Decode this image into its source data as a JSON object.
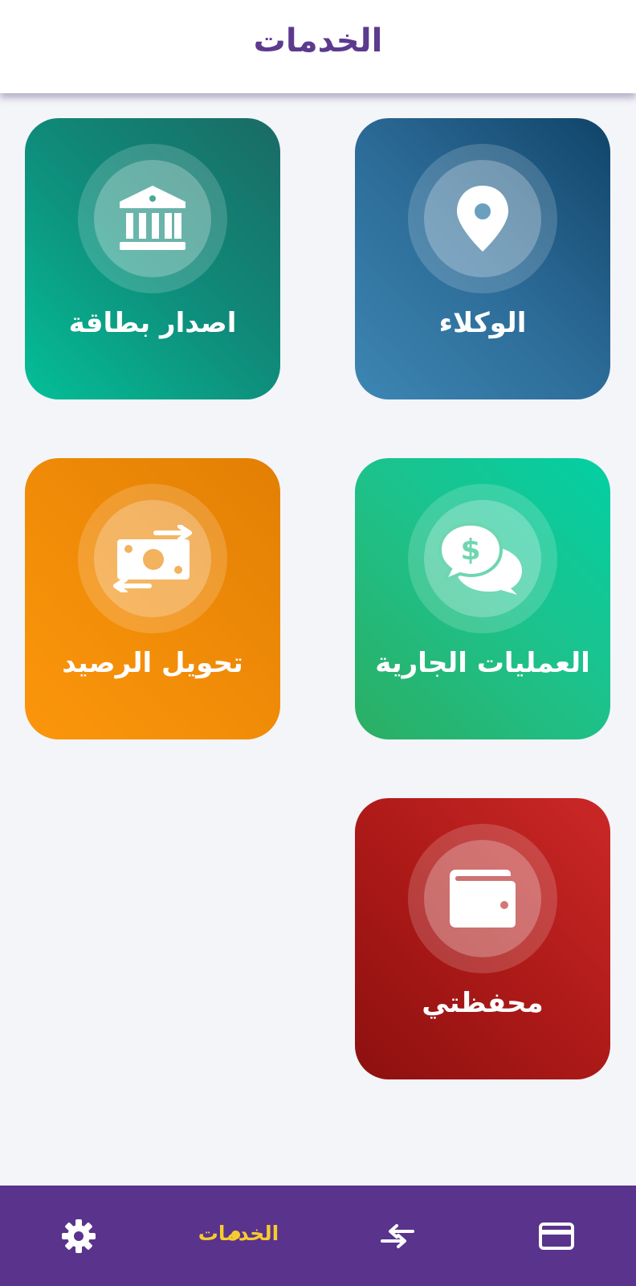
{
  "header": {
    "title": "الخدمات"
  },
  "tiles": [
    {
      "label": "الوكلاء",
      "icon": "map-pin-icon"
    },
    {
      "label": "اصدار بطاقة",
      "icon": "bank-icon"
    },
    {
      "label": "العمليات الجارية",
      "icon": "dollar-chat-icon"
    },
    {
      "label": "تحويل الرصيد",
      "icon": "money-transfer-icon"
    },
    {
      "label": "محفظتي",
      "icon": "wallet-icon"
    }
  ],
  "bottom_nav": {
    "active_label": "الخدمات",
    "items": [
      "credit-card-icon",
      "transfer-arrows-icon",
      "services-label",
      "gear-icon"
    ],
    "active_color": "#f7cb2f",
    "bar_color": "#5a338c"
  }
}
